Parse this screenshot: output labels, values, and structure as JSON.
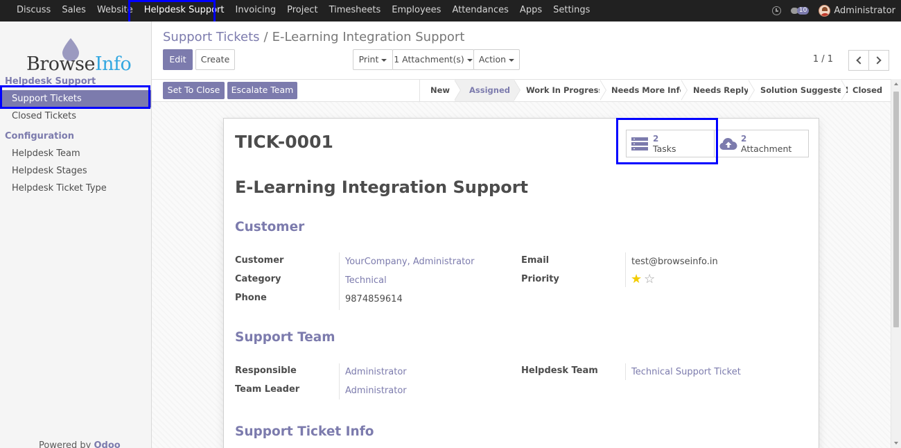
{
  "topnav": {
    "items": [
      {
        "label": "Discuss"
      },
      {
        "label": "Sales"
      },
      {
        "label": "Website"
      },
      {
        "label": "Helpdesk Support",
        "active": true
      },
      {
        "label": "Invoicing"
      },
      {
        "label": "Project"
      },
      {
        "label": "Timesheets"
      },
      {
        "label": "Employees"
      },
      {
        "label": "Attendances"
      },
      {
        "label": "Apps"
      },
      {
        "label": "Settings"
      }
    ],
    "messages_count": "10",
    "user_name": "Administrator",
    "icons": {
      "activity": "clock-icon",
      "messages": "chat-icon",
      "user": "avatar"
    }
  },
  "sidebar": {
    "logo": {
      "part1": "Browse",
      "part2": "Info"
    },
    "sections": [
      {
        "title": "Helpdesk Support",
        "items": [
          {
            "label": "Support Tickets",
            "active": true
          },
          {
            "label": "Closed Tickets"
          }
        ]
      },
      {
        "title": "Configuration",
        "items": [
          {
            "label": "Helpdesk Team"
          },
          {
            "label": "Helpdesk Stages"
          },
          {
            "label": "Helpdesk Ticket Type"
          }
        ]
      }
    ],
    "powered_by": "Powered by ",
    "powered_brand": "Odoo"
  },
  "breadcrumb": {
    "parent": "Support Tickets",
    "separator": "/",
    "current": "E-Learning Integration Support"
  },
  "toolbar": {
    "edit": "Edit",
    "create": "Create",
    "print": "Print",
    "attachments": "1 Attachment(s)",
    "action": "Action",
    "pager": "1 / 1"
  },
  "statusbar": {
    "buttons": [
      "Set To Close",
      "Escalate Team"
    ],
    "stages": [
      "New",
      "Assigned",
      "Work In Progress",
      "Needs More Info",
      "Needs Reply",
      "Solution Suggested",
      "Closed"
    ],
    "current_stage": "Assigned"
  },
  "record": {
    "reference": "TICK-0001",
    "title": "E-Learning Integration Support",
    "stat_buttons": {
      "tasks": {
        "count": "2",
        "label": "Tasks",
        "icon": "tasks-icon"
      },
      "attachment": {
        "count": "2",
        "label": "Attachment",
        "icon": "cloud-upload-icon"
      }
    },
    "customer_section": {
      "title": "Customer",
      "customer_label": "Customer",
      "customer": "YourCompany, Administrator",
      "category_label": "Category",
      "category": "Technical",
      "phone_label": "Phone",
      "phone": "9874859614",
      "email_label": "Email",
      "email": "test@browseinfo.in",
      "priority_label": "Priority",
      "priority": 1,
      "priority_max": 2
    },
    "team_section": {
      "title": "Support Team",
      "responsible_label": "Responsible",
      "responsible": "Administrator",
      "leader_label": "Team Leader",
      "leader": "Administrator",
      "helpdesk_team_label": "Helpdesk Team",
      "helpdesk_team": "Technical Support Ticket"
    },
    "info_section": {
      "title": "Support Ticket Info"
    }
  },
  "colors": {
    "accent": "#7c7bad",
    "navbar": "#212121",
    "highlight": "#0000ff",
    "star": "#f3cc00"
  }
}
